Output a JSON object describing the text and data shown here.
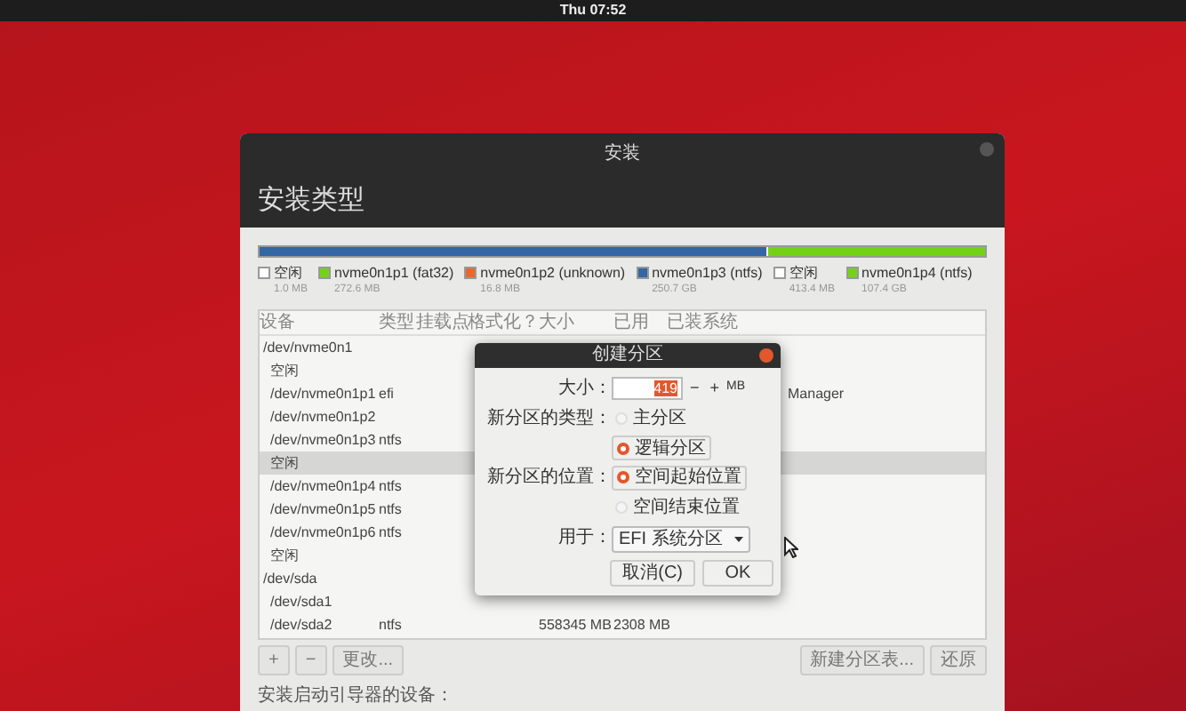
{
  "top_bar": {
    "clock": "Thu 07:52"
  },
  "window": {
    "title": "安装",
    "heading": "安装类型"
  },
  "disk_bar": [
    {
      "name": "空闲",
      "size": "1.0 MB",
      "color": "#ffffff"
    },
    {
      "name": "nvme0n1p1 (fat32)",
      "size": "272.6 MB",
      "color": "#73d216"
    },
    {
      "name": "nvme0n1p2 (unknown)",
      "size": "16.8 MB",
      "color": "#e9692c"
    },
    {
      "name": "nvme0n1p3 (ntfs)",
      "size": "250.7 GB",
      "color": "#3465a4"
    },
    {
      "name": "空闲",
      "size": "413.4 MB",
      "color": "#ffffff"
    },
    {
      "name": "nvme0n1p4 (ntfs)",
      "size": "107.4 GB",
      "color": "#73d216"
    }
  ],
  "table": {
    "columns": [
      "设备",
      "类型",
      "挂载点",
      "格式化？",
      "大小",
      "已用",
      "已装系统"
    ],
    "rows": [
      {
        "device": "/dev/nvme0n1",
        "selected": false,
        "children": [
          {
            "device": "空闲",
            "selected": false
          },
          {
            "device": "/dev/nvme0n1p1",
            "type": "efi",
            "installed_system": "Manager",
            "selected": false
          },
          {
            "device": "/dev/nvme0n1p2",
            "selected": false
          },
          {
            "device": "/dev/nvme0n1p3",
            "type": "ntfs",
            "selected": false
          },
          {
            "device": "空闲",
            "selected": true
          },
          {
            "device": "/dev/nvme0n1p4",
            "type": "ntfs",
            "selected": false
          },
          {
            "device": "/dev/nvme0n1p5",
            "type": "ntfs",
            "selected": false
          },
          {
            "device": "/dev/nvme0n1p6",
            "type": "ntfs",
            "selected": false
          },
          {
            "device": "空闲",
            "selected": false
          }
        ]
      },
      {
        "device": "/dev/sda",
        "selected": false,
        "children": [
          {
            "device": "/dev/sda1",
            "selected": false
          },
          {
            "device": "/dev/sda2",
            "type": "ntfs",
            "size": "558345 MB",
            "used": "2308 MB",
            "selected": false
          }
        ]
      }
    ]
  },
  "table_buttons": {
    "add": "+",
    "remove": "−",
    "change": "更改...",
    "new_table": "新建分区表...",
    "revert": "还原"
  },
  "boot_loader_label": "安装启动引导器的设备：",
  "dialog": {
    "title": "创建分区",
    "size_label": "大小：",
    "size_value": "419",
    "minus": "−",
    "plus": "+",
    "unit": "MB",
    "type_label": "新分区的类型：",
    "type_options": [
      {
        "label": "主分区",
        "selected": false
      },
      {
        "label": "逻辑分区",
        "selected": true
      }
    ],
    "location_label": "新分区的位置：",
    "location_options": [
      {
        "label": "空间起始位置",
        "selected": true
      },
      {
        "label": "空间结束位置",
        "selected": false
      }
    ],
    "use_label": "用于：",
    "use_value": "EFI 系统分区",
    "buttons": [
      "取消(C)",
      "OK"
    ]
  }
}
